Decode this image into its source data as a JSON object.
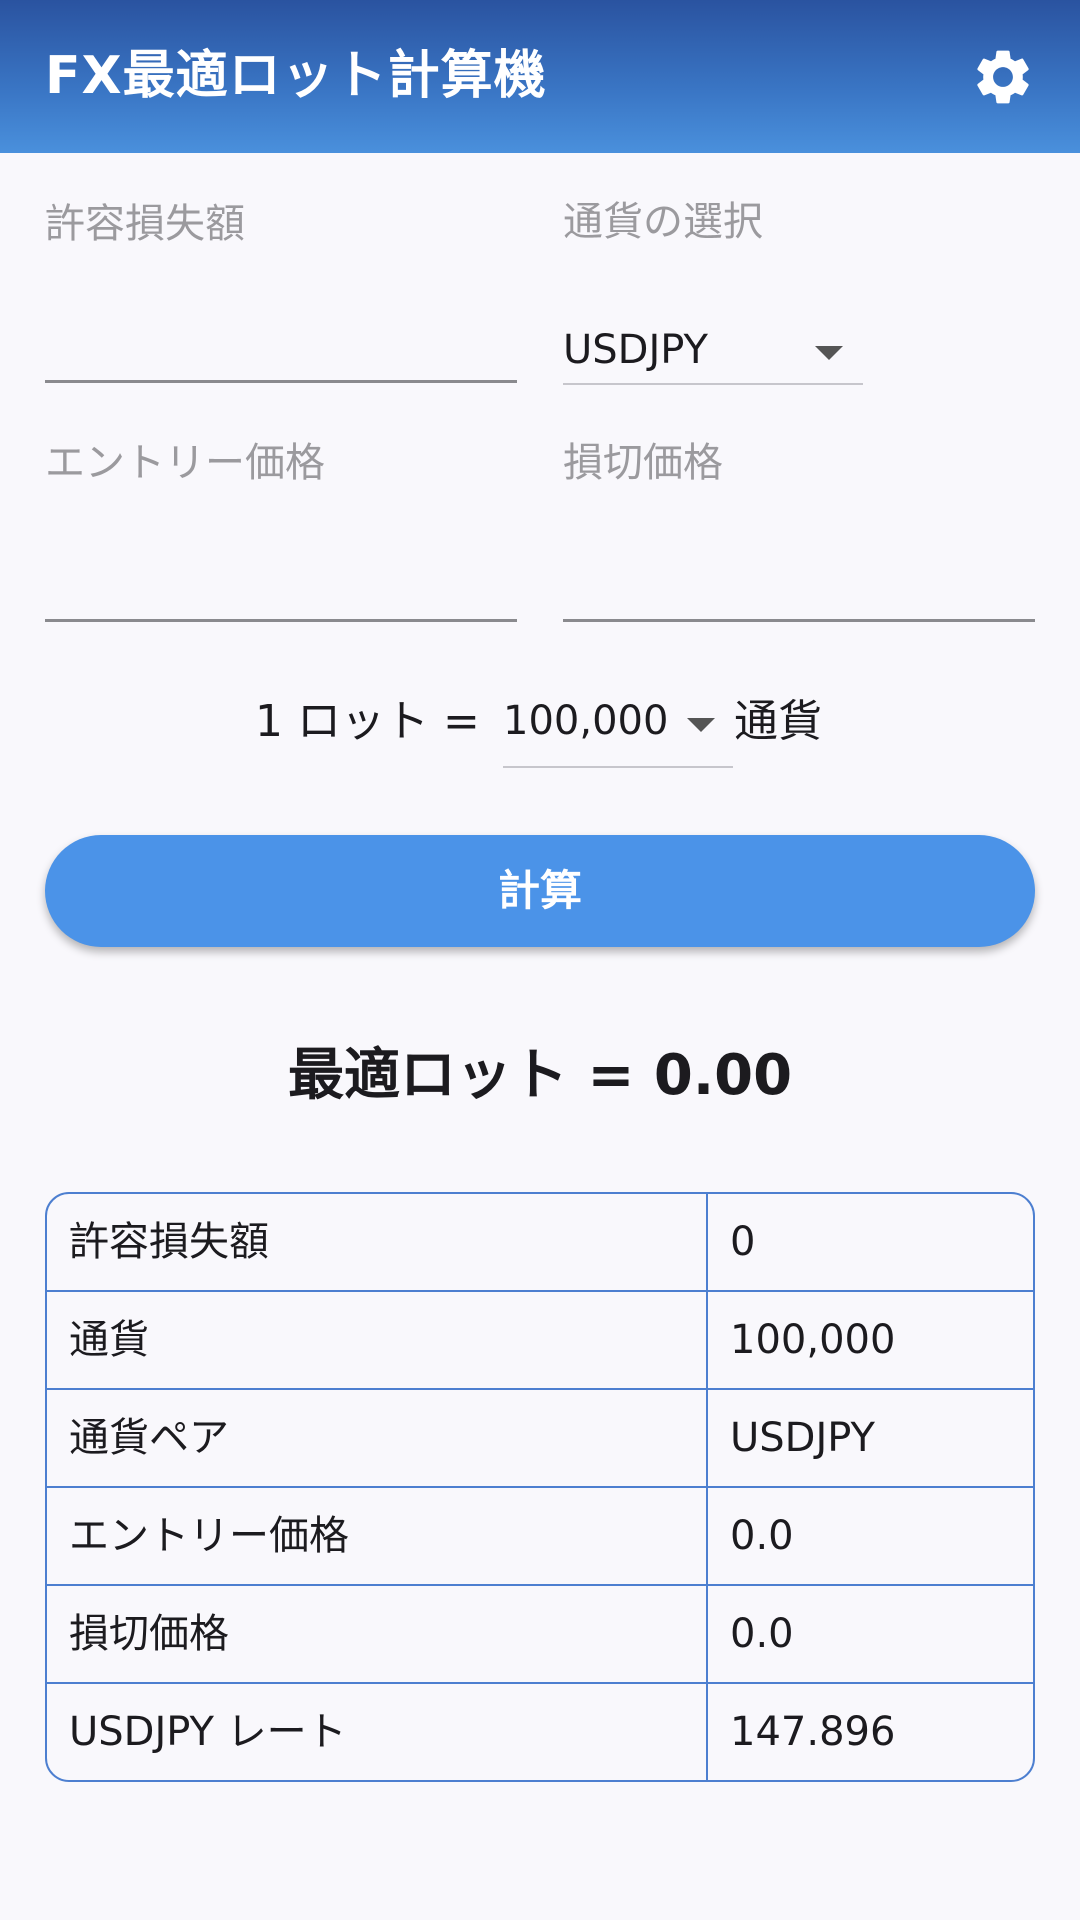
{
  "app_bar": {
    "title": "FX最適ロット計算機",
    "settings_icon": "gear-icon"
  },
  "form": {
    "allowable_loss": {
      "label": "許容損失額",
      "value": ""
    },
    "currency_select": {
      "label": "通貨の選択",
      "selected": "USDJPY"
    },
    "entry_price": {
      "label": "エントリー価格",
      "value": ""
    },
    "stop_loss_price": {
      "label": "損切価格",
      "value": ""
    }
  },
  "lot_setting": {
    "prefix": "1 ロット =",
    "selected": "100,000",
    "suffix": "通貨"
  },
  "calculate_button": {
    "label": "計算"
  },
  "result": {
    "text": "最適ロット = 0.00"
  },
  "summary": [
    {
      "key": "許容損失額",
      "value": "0"
    },
    {
      "key": "通貨",
      "value": "100,000"
    },
    {
      "key": "通貨ペア",
      "value": "USDJPY"
    },
    {
      "key": "エントリー価格",
      "value": "0.0"
    },
    {
      "key": "損切価格",
      "value": "0.0"
    },
    {
      "key": "USDJPY レート",
      "value": "147.896"
    }
  ],
  "colors": {
    "app_bar_top": "#2a53a0",
    "app_bar_bottom": "#4a90dc",
    "button": "#4b93e8",
    "table_border": "#4d7fd0"
  }
}
